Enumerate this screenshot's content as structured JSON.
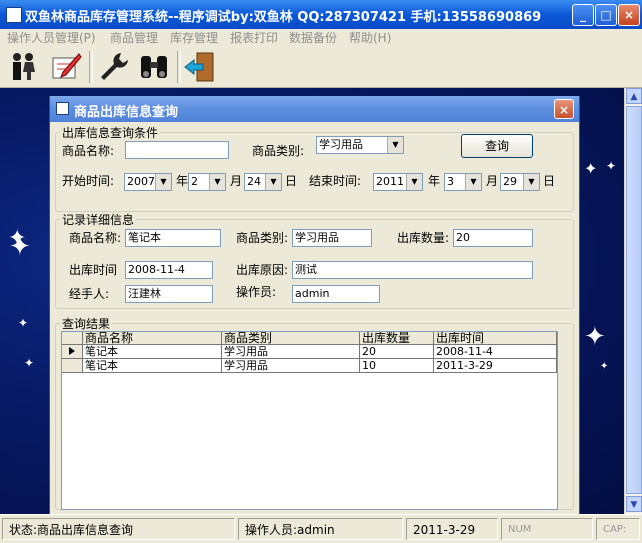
{
  "window": {
    "title": "双鱼林商品库存管理系统--程序调试by:双鱼林 QQ:287307421 手机:13558690869",
    "controls": [
      "_",
      "□",
      "×"
    ]
  },
  "menu": [
    "操作人员管理(P)",
    "商品管理",
    "库存管理",
    "报表打印",
    "数据备份",
    "帮助(H)"
  ],
  "toolbar": {
    "icons": [
      "users-icon",
      "edit-form-icon",
      "wrench-icon",
      "binoculars-icon",
      "exit-door-icon"
    ]
  },
  "child_window": {
    "title": "商品出库信息查询",
    "close": "×",
    "query_group": {
      "legend": "出库信息查询条件",
      "name_label": "商品名称:",
      "name_value": "",
      "category_label": "商品类别:",
      "category_value": "学习用品",
      "query_button": "查询",
      "start_label": "开始时间:",
      "start_year": "2007",
      "start_month": "2",
      "start_day": "24",
      "end_label": "结束时间:",
      "end_year": "2011",
      "end_month": "3",
      "end_day": "29",
      "year_unit": "年",
      "month_unit": "月",
      "day_unit": "日"
    },
    "detail_group": {
      "legend": "记录详细信息",
      "name_label": "商品名称:",
      "name_value": "笔记本",
      "category_label": "商品类别:",
      "category_value": "学习用品",
      "qty_label": "出库数量:",
      "qty_value": "20",
      "time_label": "出库时间",
      "time_value": "2008-11-4",
      "reason_label": "出库原因:",
      "reason_value": "测试",
      "handler_label": "经手人:",
      "handler_value": "汪建林",
      "operator_label": "操作员:",
      "operator_value": "admin"
    },
    "results_group": {
      "legend": "查询结果",
      "columns": [
        "商品名称",
        "商品类别",
        "出库数量",
        "出库时间"
      ],
      "rows": [
        [
          "笔记本",
          "学习用品",
          "20",
          "2008-11-4"
        ],
        [
          "笔记本",
          "学习用品",
          "10",
          "2011-3-29"
        ]
      ]
    }
  },
  "status_bar": {
    "state": "状态:商品出库信息查询",
    "operator": "操作人员:admin",
    "date": "2011-3-29",
    "num": "NUM",
    "caps": "CAP:"
  }
}
